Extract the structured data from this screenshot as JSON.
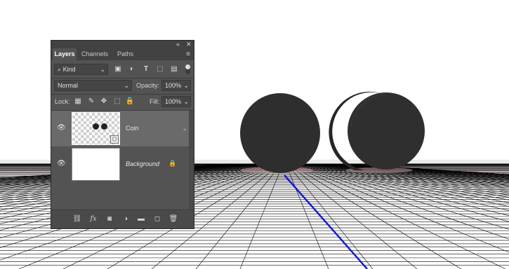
{
  "panel": {
    "collapse_icon": "«",
    "close_icon": "✕",
    "tabs": [
      {
        "label": "Layers"
      },
      {
        "label": "Channels"
      },
      {
        "label": "Paths"
      }
    ],
    "menu_icon": "≡",
    "filter": {
      "kind_label": "Kind",
      "search_icon": "⌕"
    },
    "blend": {
      "mode": "Normal",
      "opacity_label": "Opacity:",
      "opacity_value": "100%"
    },
    "lock": {
      "label": "Lock:",
      "fill_label": "Fill:",
      "fill_value": "100%"
    },
    "layers": [
      {
        "name": "Coin",
        "selected": true
      },
      {
        "name": "Background",
        "selected": false
      }
    ],
    "bottom": {
      "fx_label": "fx"
    }
  },
  "colors": {
    "panel_bg": "#535353",
    "panel_dark": "#424242",
    "selected_layer": "#6a6a6a",
    "coin": "#2e2e2e",
    "grid_line": "#000000",
    "axis_blue": "#1212d8",
    "horizon_red": "#f0c8c8"
  }
}
